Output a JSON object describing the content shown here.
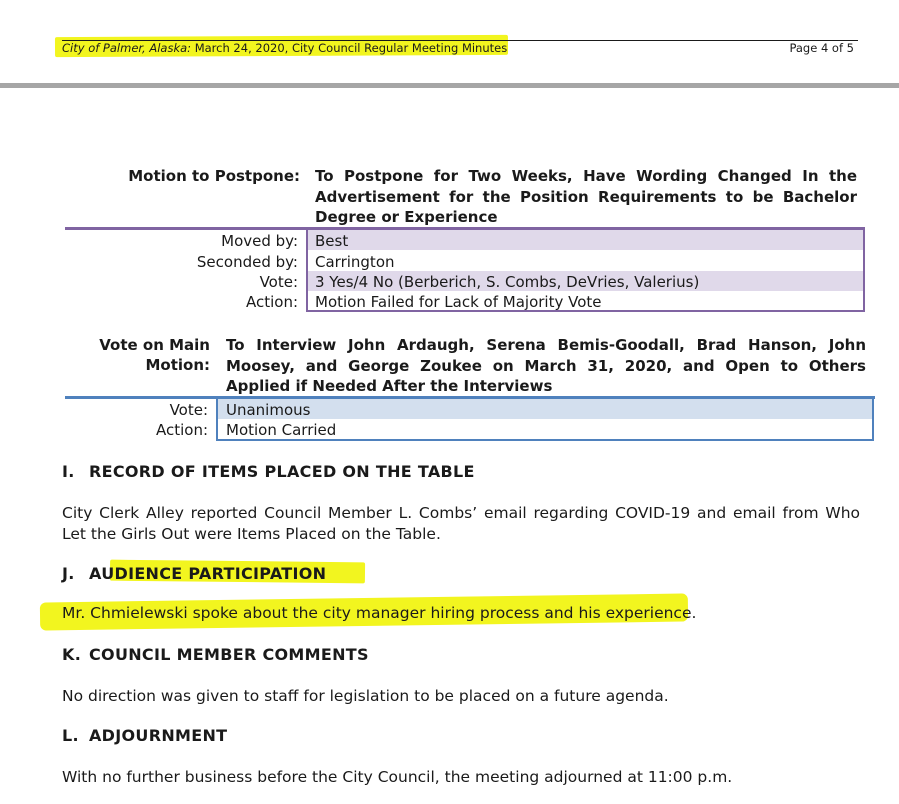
{
  "header": {
    "city": "City of Palmer, Alaska:",
    "title_rest": " March 24, 2020, City Council Regular Meeting Minutes",
    "page": "Page 4 of 5"
  },
  "motion_postpone": {
    "label": "Motion to Postpone:",
    "text": "To Postpone for Two Weeks, Have Wording Changed In the Advertisement for the Position Requirements to be Bachelor Degree or Experience",
    "rows": [
      {
        "label": "Moved by:",
        "value": "Best"
      },
      {
        "label": "Seconded by:",
        "value": "Carrington"
      },
      {
        "label": "Vote:",
        "value": "3 Yes/4 No (Berberich, S. Combs, DeVries, Valerius)"
      },
      {
        "label": "Action:",
        "value": "Motion Failed for Lack of Majority Vote"
      }
    ],
    "border_color": "#8064a2",
    "band_color": "#e0d9ea"
  },
  "main_motion": {
    "label_line1": "Vote on Main",
    "label_line2": "Motion:",
    "text": "To Interview John Ardaugh, Serena Bemis-Goodall, Brad Hanson, John Moosey, and George Zoukee on March 31, 2020, and Open to Others Applied if Needed After the Interviews",
    "rows": [
      {
        "label": "Vote:",
        "value": "Unanimous"
      },
      {
        "label": "Action:",
        "value": "Motion Carried"
      }
    ],
    "border_color": "#4f81bd",
    "band_color": "#d3dfee"
  },
  "sections": [
    {
      "num": "I.",
      "title": "RECORD OF ITEMS PLACED ON THE TABLE",
      "body": "City Clerk Alley reported Council Member L. Combs’ email regarding COVID-19 and email from Who Let the Girls Out were Items Placed on the Table."
    },
    {
      "num": "J.",
      "title": "AUDIENCE PARTICIPATION",
      "body": "Mr. Chmielewski spoke about the city manager hiring process and his experience."
    },
    {
      "num": "K.",
      "title": "COUNCIL MEMBER COMMENTS",
      "body": "No direction was given to staff for legislation to be placed on a future agenda."
    },
    {
      "num": "L.",
      "title": "ADJOURNMENT",
      "body": "With no further business before the City Council, the meeting adjourned at 11:00 p.m."
    }
  ],
  "highlight_color": "#f2f51f"
}
